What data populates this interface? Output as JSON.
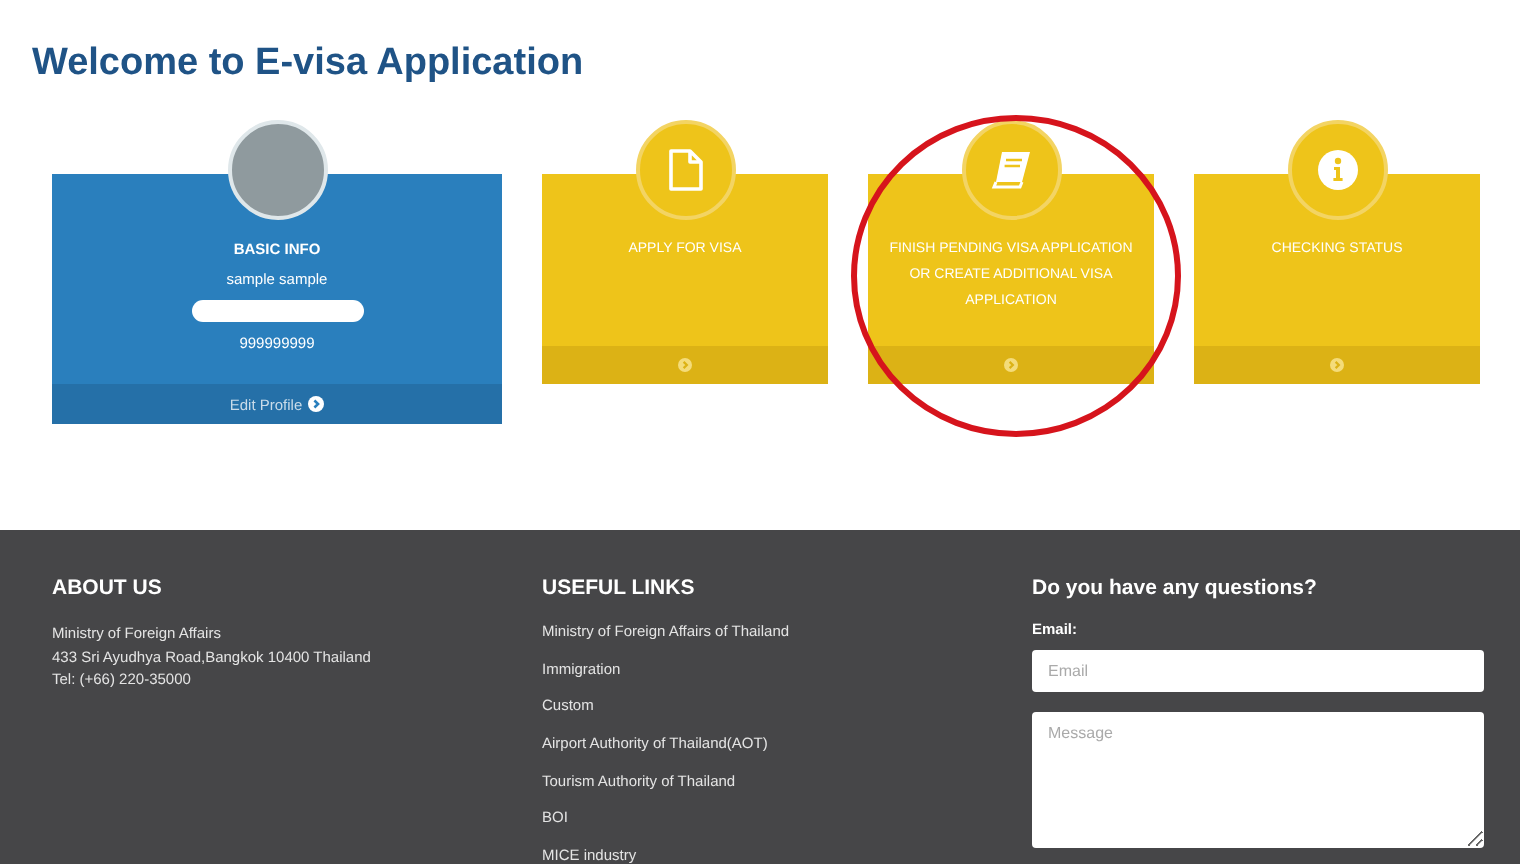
{
  "page_title": "Welcome to E-visa Application",
  "profile_card": {
    "title": "BASIC INFO",
    "name": "sample sample",
    "phone": "999999999",
    "edit_link": "Edit Profile"
  },
  "action_cards": [
    {
      "kind": "document",
      "label": "APPLY FOR VISA"
    },
    {
      "kind": "book",
      "label": "FINISH PENDING VISA APPLICATION OR CREATE ADDITIONAL VISA APPLICATION"
    },
    {
      "kind": "info",
      "label": "CHECKING STATUS"
    }
  ],
  "footer": {
    "about": {
      "heading": "ABOUT US",
      "lines": [
        "Ministry of Foreign Affairs",
        "433 Sri Ayudhya Road,Bangkok 10400 Thailand",
        "Tel: (+66) 220-35000"
      ]
    },
    "links": {
      "heading": "USEFUL LINKS",
      "items": [
        "Ministry of Foreign Affairs of Thailand",
        "Immigration",
        "Custom",
        "Airport Authority of Thailand(AOT)",
        "Tourism Authority of Thailand",
        "BOI",
        "MICE industry"
      ]
    },
    "contact": {
      "heading": "Do you have any questions?",
      "email_label": "Email:",
      "email_placeholder": "Email",
      "message_placeholder": "Message"
    }
  }
}
